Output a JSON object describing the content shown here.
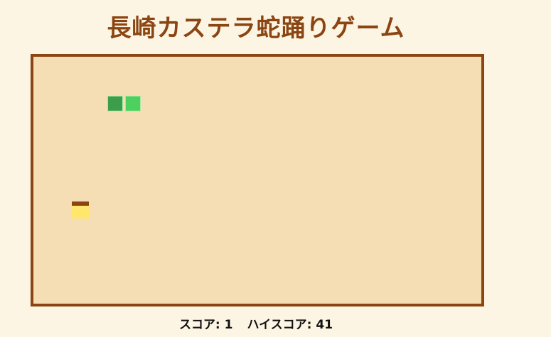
{
  "game": {
    "title": "長崎カステラ蛇踊りゲーム"
  },
  "board": {
    "background": "#f5deb3",
    "border_color": "#8b4513"
  },
  "snake": {
    "head_color": "#4cd05e",
    "body_color": "#3c9e4a",
    "segment_count": 2
  },
  "food": {
    "name": "castella",
    "crust_color": "#8b4513",
    "sponge_color": "#ffe66d"
  },
  "scoreboard": {
    "score_label": "スコア:",
    "score_value": "1",
    "high_score_label": "ハイスコア:",
    "high_score_value": "41"
  }
}
